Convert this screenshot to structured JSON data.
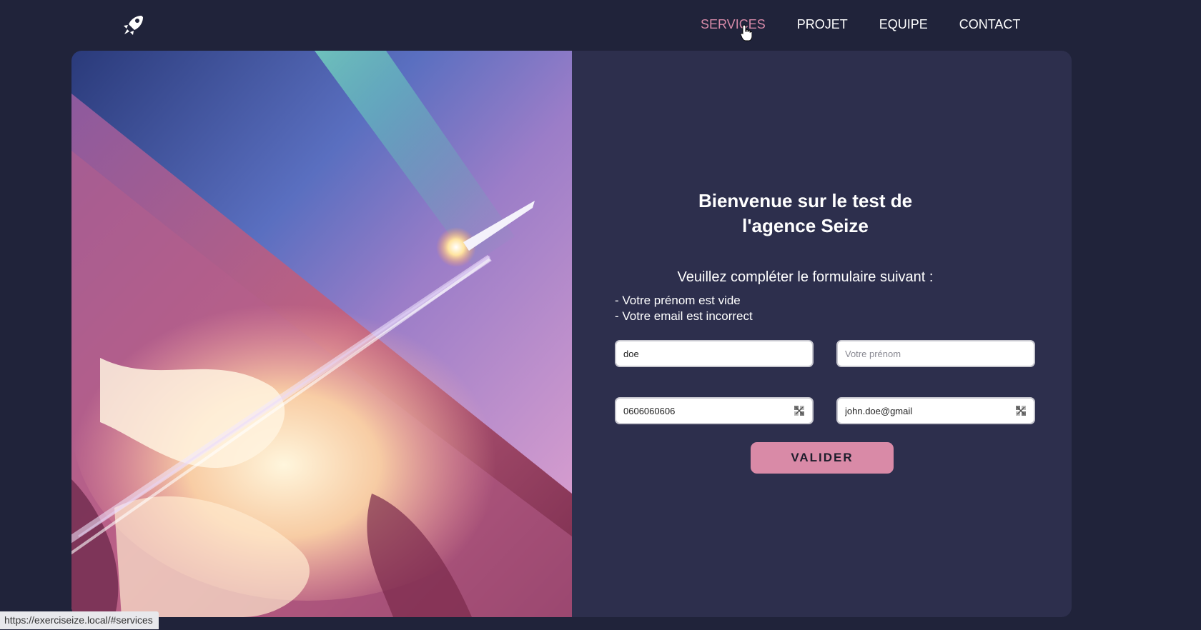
{
  "nav": {
    "items": [
      {
        "label": "SERVICES",
        "active": true
      },
      {
        "label": "PROJET",
        "active": false
      },
      {
        "label": "EQUIPE",
        "active": false
      },
      {
        "label": "CONTACT",
        "active": false
      }
    ]
  },
  "logo": {
    "icon": "rocket-icon"
  },
  "form": {
    "title_line1": "Bienvenue sur le test de",
    "title_line2": "l'agence Seize",
    "subtitle": "Veuillez compléter le formulaire suivant :",
    "errors": [
      "- Votre prénom est vide",
      "- Votre email est incorrect"
    ],
    "fields": {
      "lastname": {
        "value": "doe",
        "placeholder": ""
      },
      "firstname": {
        "value": "",
        "placeholder": "Votre prénom"
      },
      "phone": {
        "value": "0606060606",
        "placeholder": ""
      },
      "email": {
        "value": "john.doe@gmail",
        "placeholder": ""
      }
    },
    "submit_label": "VALIDER"
  },
  "status_bar": {
    "url": "https://exerciseize.local/#services"
  },
  "colors": {
    "background": "#20233a",
    "card": "#2d2f4d",
    "accent": "#d98aa7",
    "nav_active": "#d68aa8"
  }
}
